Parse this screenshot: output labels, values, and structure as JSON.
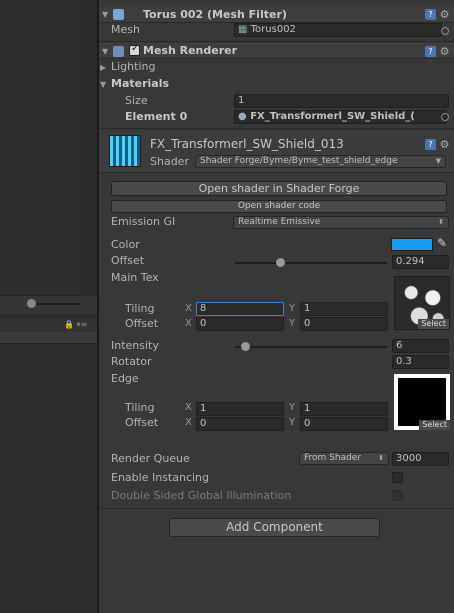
{
  "mesh_filter": {
    "title": "Torus 002 (Mesh Filter)",
    "mesh_label": "Mesh",
    "mesh_value": "Torus002"
  },
  "mesh_renderer": {
    "title": "Mesh Renderer",
    "enabled": true,
    "lighting_label": "Lighting",
    "materials_label": "Materials",
    "size_label": "Size",
    "size_value": "1",
    "element0_label": "Element 0",
    "element0_value": "FX_Transformerl_SW_Shield_("
  },
  "material": {
    "name": "FX_Transformerl_SW_Shield_013",
    "shader_label": "Shader",
    "shader_value": "Shader Forge/Byme/Byme_test_shield_edge",
    "open_shader_forge": "Open shader in Shader Forge",
    "open_shader_code": "Open shader code",
    "emission_gi_label": "Emission GI",
    "emission_gi_value": "Realtime Emissive",
    "color_label": "Color",
    "color_value": "#1a9af0",
    "offset_label": "Offset",
    "offset_value": "0.294",
    "offset_fraction": 0.294,
    "main_tex_label": "Main Tex",
    "main_tex": {
      "tiling_label": "Tiling",
      "tiling_x": "8",
      "tiling_y": "1",
      "offset_label": "Offset",
      "offset_x": "0",
      "offset_y": "0",
      "select_label": "Select"
    },
    "intensity_label": "Intensity",
    "intensity_value": "6",
    "rotator_label": "Rotator",
    "rotator_value": "0.3",
    "edge_label": "Edge",
    "edge_tex": {
      "tiling_label": "Tiling",
      "tiling_x": "1",
      "tiling_y": "1",
      "offset_label": "Offset",
      "offset_x": "0",
      "offset_y": "0",
      "select_label": "Select"
    },
    "x_label": "X",
    "y_label": "Y",
    "render_queue_label": "Render Queue",
    "render_queue_mode": "From Shader",
    "render_queue_value": "3000",
    "enable_instancing_label": "Enable Instancing",
    "double_sided_gi_label": "Double Sided Global Illumination"
  },
  "add_component_label": "Add Component"
}
